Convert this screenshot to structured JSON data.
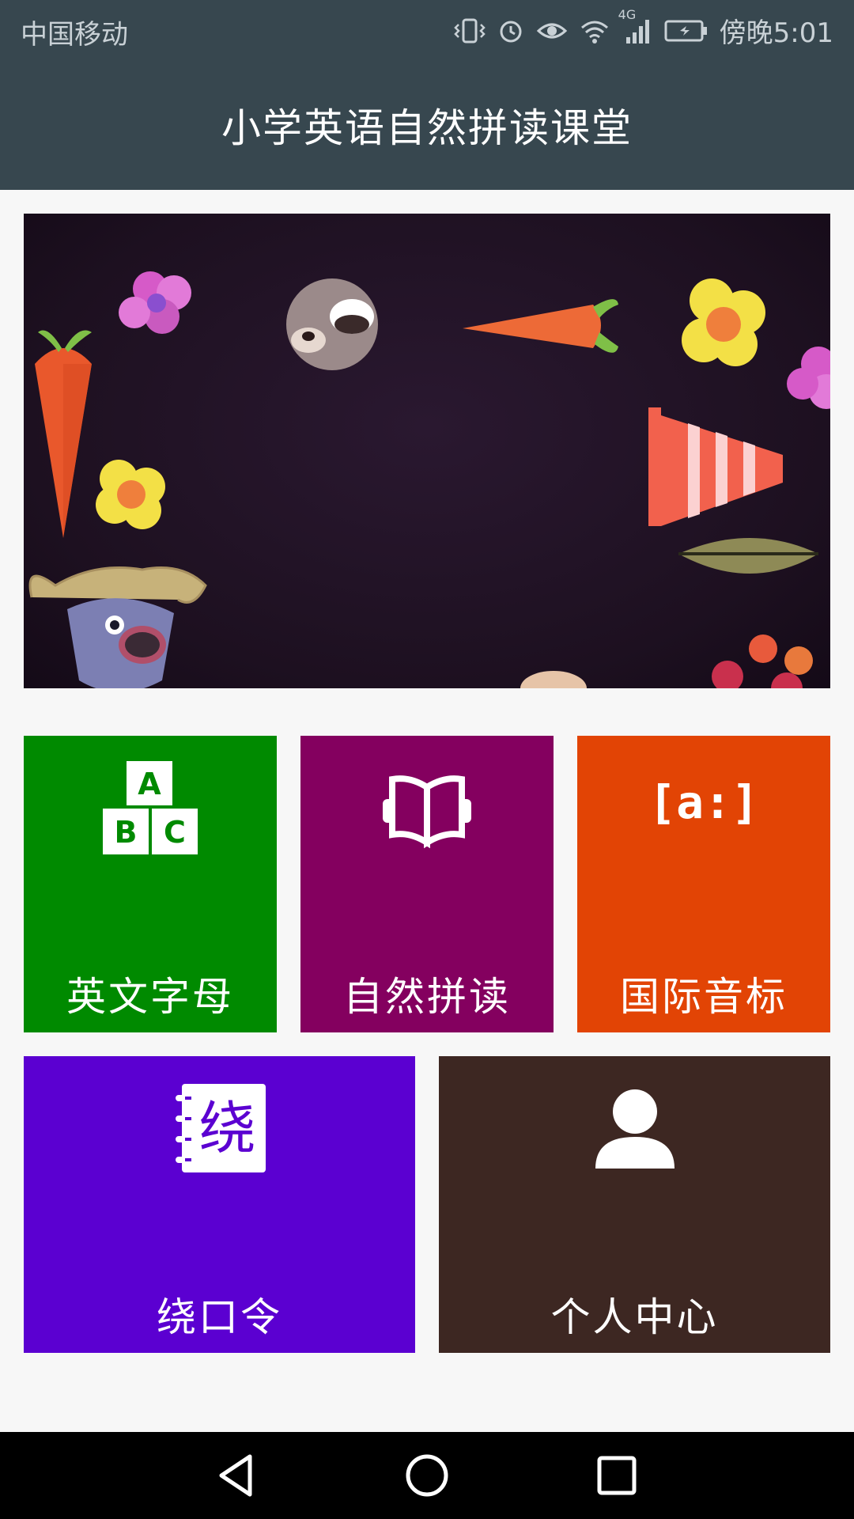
{
  "status": {
    "carrier": "中国移动",
    "network": "4G",
    "time": "傍晚5:01"
  },
  "header": {
    "title": "小学英语自然拼读课堂"
  },
  "tiles": [
    {
      "label": "英文字母",
      "color": "#008a00",
      "icon": "abc-blocks-icon"
    },
    {
      "label": "自然拼读",
      "color": "#84005f",
      "icon": "open-book-icon"
    },
    {
      "label": "国际音标",
      "color": "#e24405",
      "icon": "phonetic-symbol-icon",
      "icon_text": "[a:]"
    },
    {
      "label": "绕口令",
      "color": "#5b00d1",
      "icon": "notebook-icon",
      "icon_text": "绕"
    },
    {
      "label": "个人中心",
      "color": "#3d2722",
      "icon": "user-icon"
    }
  ],
  "abc_icon": {
    "a": "A",
    "b": "B",
    "c": "C"
  },
  "colors": {
    "app_bar": "#37474f",
    "background": "#f7f7f7",
    "nav_bar": "#000000"
  }
}
